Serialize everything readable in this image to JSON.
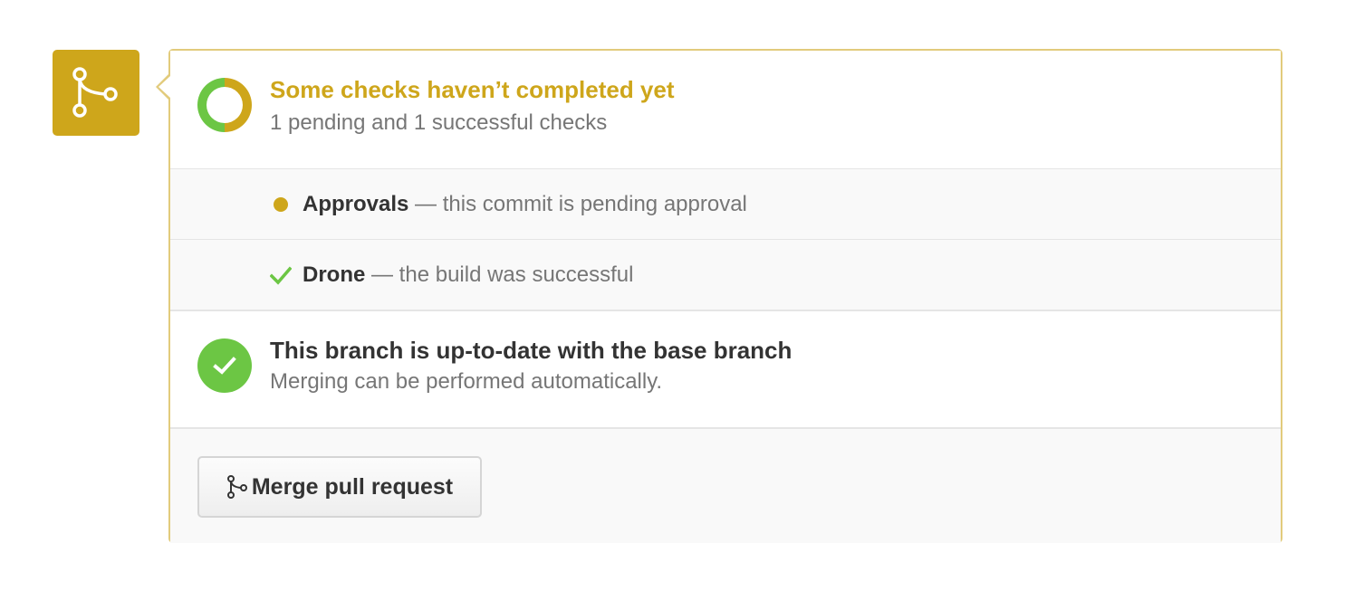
{
  "colors": {
    "accent_pending": "#cea61b",
    "accent_success": "#6cc644",
    "panel_border": "#e2cb7c",
    "muted_text": "#767676",
    "strong_text": "#333333"
  },
  "merge_status_icon": "git-merge-icon",
  "checks_summary": {
    "title": "Some checks haven’t completed yet",
    "subtitle": "1 pending and 1 successful checks",
    "icon": "pending-donut-icon"
  },
  "checks": [
    {
      "name": "Approvals",
      "description": "— this commit is pending approval",
      "status": "pending",
      "icon": "pending-dot-icon"
    },
    {
      "name": "Drone",
      "description": "— the build was successful",
      "status": "success",
      "icon": "checkmark-icon"
    }
  ],
  "branch_status": {
    "title": "This branch is up-to-date with the base branch",
    "subtitle": "Merging can be performed automatically.",
    "icon": "check-circle-icon"
  },
  "merge_button": {
    "label": "Merge pull request",
    "icon": "git-merge-icon"
  }
}
